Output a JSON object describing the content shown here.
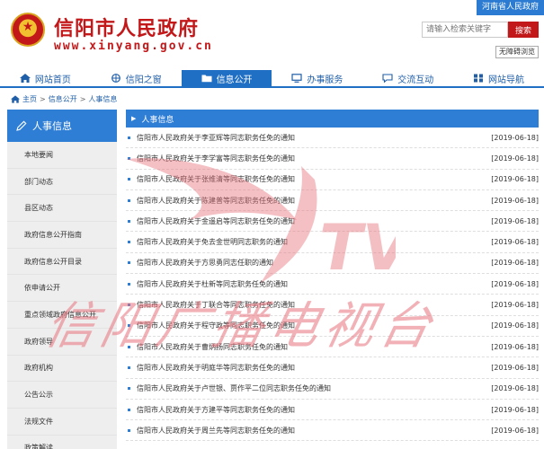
{
  "header": {
    "site_title": "信阳市人民政府",
    "site_domain": "www.xinyang.gov.cn",
    "province_link": "河南省人民政府",
    "search_placeholder": "请输入检索关键字",
    "search_button": "搜索",
    "barrier_free": "无障碍浏览"
  },
  "nav": [
    {
      "label": "网站首页",
      "icon": "home-icon"
    },
    {
      "label": "信阳之窗",
      "icon": "globe-icon"
    },
    {
      "label": "信息公开",
      "icon": "folder-icon"
    },
    {
      "label": "办事服务",
      "icon": "monitor-icon"
    },
    {
      "label": "交流互动",
      "icon": "chat-icon"
    },
    {
      "label": "网站导航",
      "icon": "grid-icon"
    }
  ],
  "breadcrumb": {
    "items": [
      "主页",
      "信息公开",
      "人事信息"
    ],
    "separator": ">"
  },
  "sidebar": {
    "title": "人事信息",
    "items": [
      "本地要闻",
      "部门动态",
      "县区动态",
      "政府信息公开指南",
      "政府信息公开目录",
      "依申请公开",
      "重点领域政府信息公开",
      "政府领导",
      "政府机构",
      "公告公示",
      "法规文件",
      "政策解读"
    ]
  },
  "content": {
    "title": "人事信息",
    "rows": [
      {
        "title": "信阳市人民政府关于李亚辉等同志职务任免的通知",
        "date": "[2019-06-18]"
      },
      {
        "title": "信阳市人民政府关于李学富等同志职务任免的通知",
        "date": "[2019-06-18]"
      },
      {
        "title": "信阳市人民政府关于张维清等同志职务任免的通知",
        "date": "[2019-06-18]"
      },
      {
        "title": "信阳市人民政府关于陈建普等同志职务任免的通知",
        "date": "[2019-06-18]"
      },
      {
        "title": "信阳市人民政府关于金遥启等同志职务任免的通知",
        "date": "[2019-06-18]"
      },
      {
        "title": "信阳市人民政府关于免去金世明同志职务的通知",
        "date": "[2019-06-18]"
      },
      {
        "title": "信阳市人民政府关于方思勇同志任职的通知",
        "date": "[2019-06-18]"
      },
      {
        "title": "信阳市人民政府关于杜新等同志职务任免的通知",
        "date": "[2019-06-18]"
      },
      {
        "title": "信阳市人民政府关于丁联合等同志职务任免的通知",
        "date": "[2019-06-18]"
      },
      {
        "title": "信阳市人民政府关于程守政等同志职务任免的通知",
        "date": "[2019-06-18]"
      },
      {
        "title": "信阳市人民政府关于曹炳扬同志职务任免的通知",
        "date": "[2019-06-18]"
      },
      {
        "title": "信阳市人民政府关于明庭华等同志职务任免的通知",
        "date": "[2019-06-18]"
      },
      {
        "title": "信阳市人民政府关于卢世银、贾作平二位同志职务任免的通知",
        "date": "[2019-06-18]"
      },
      {
        "title": "信阳市人民政府关于方建平等同志职务任免的通知",
        "date": "[2019-06-18]"
      },
      {
        "title": "信阳市人民政府关于周兰先等同志职务任免的通知",
        "date": "[2019-06-18]"
      }
    ]
  },
  "watermark": {
    "text": "信阳广播电视台",
    "logo_letters": "TV"
  },
  "colors": {
    "brand_red": "#c3181a",
    "nav_blue": "#1f6fc5",
    "panel_blue": "#2f7ed6",
    "watermark_pink": "#e7737c"
  }
}
